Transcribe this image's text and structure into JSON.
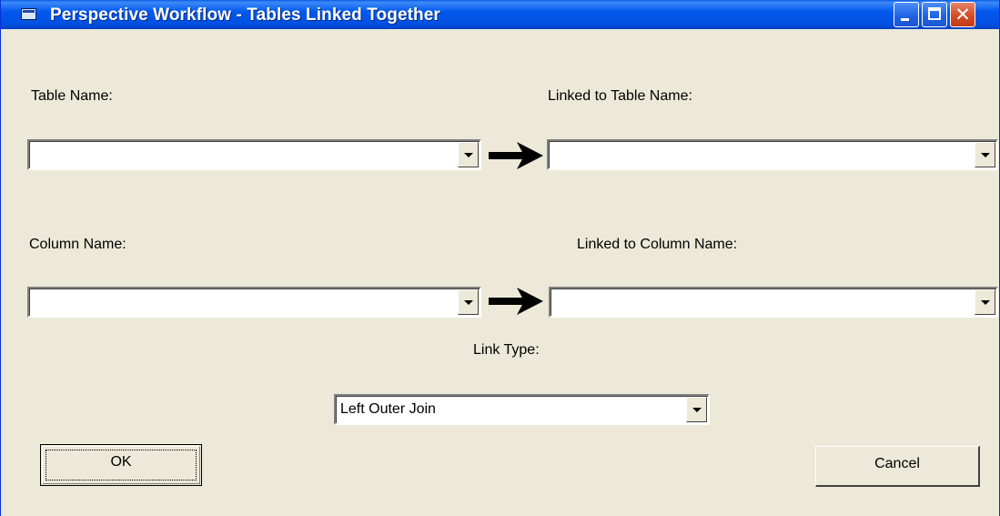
{
  "window": {
    "title": "Perspective Workflow - Tables Linked Together",
    "controls": {
      "minimize": "minimize",
      "maximize": "maximize",
      "close": "✕"
    }
  },
  "form": {
    "table_name_label": "Table Name:",
    "linked_table_label": "Linked to Table Name:",
    "column_name_label": "Column Name:",
    "linked_column_label": "Linked to Column Name:",
    "link_type_label": "Link Type:",
    "table_name_value": "",
    "linked_table_value": "",
    "column_name_value": "",
    "linked_column_value": "",
    "link_type_value": "Left Outer Join"
  },
  "buttons": {
    "ok": "OK",
    "cancel": "Cancel"
  }
}
